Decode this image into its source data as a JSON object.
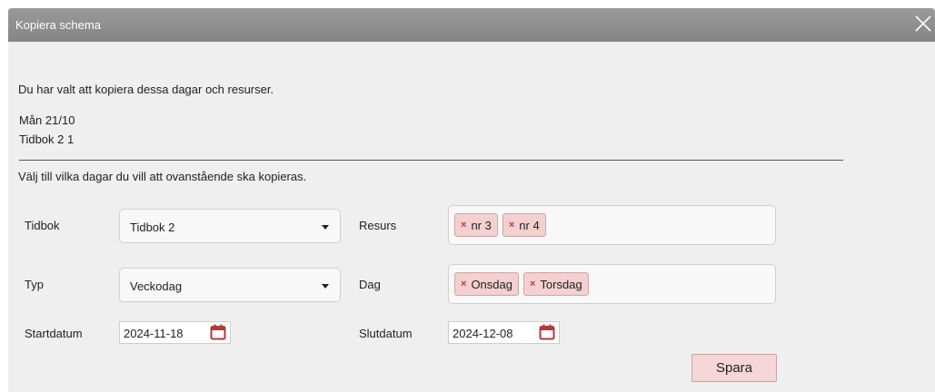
{
  "dialog": {
    "title": "Kopiera schema",
    "intro": "Du har valt att kopiera dessa dagar och resurser.",
    "selected_day": "Mån 21/10",
    "selected_resource": "Tidbok 2 1",
    "instruction": "Välj till vilka dagar du vill att ovanstående ska kopieras."
  },
  "form": {
    "tidbok": {
      "label": "Tidbok",
      "value": "Tidbok 2"
    },
    "resurs": {
      "label": "Resurs",
      "tags": [
        "nr 3",
        "nr 4"
      ]
    },
    "typ": {
      "label": "Typ",
      "value": "Veckodag"
    },
    "dag": {
      "label": "Dag",
      "tags": [
        "Onsdag",
        "Torsdag"
      ]
    },
    "startdatum": {
      "label": "Startdatum",
      "value": "2024-11-18"
    },
    "slutdatum": {
      "label": "Slutdatum",
      "value": "2024-12-08"
    },
    "save_label": "Spara"
  },
  "colors": {
    "titlebar": "#8e8e8e",
    "panel": "#efefef",
    "accent": "#f4d0d0",
    "remove_x": "#c0392b",
    "calendar_icon": "#b23a3a"
  },
  "icons": {
    "close": "close-icon",
    "calendar": "calendar-icon",
    "remove": "remove-tag-icon",
    "dropdown": "chevron-down-icon"
  }
}
